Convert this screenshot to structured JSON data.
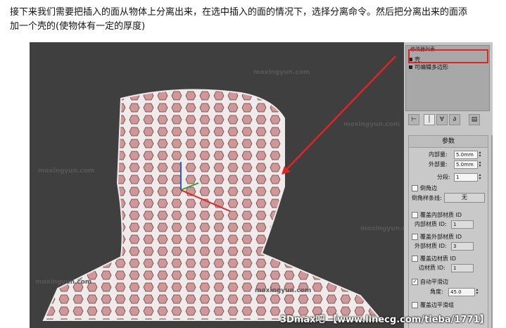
{
  "intro": {
    "line1": "接下来我们需要把插入的面从物体上分离出来，在选中插入的面的情况下，选择分离命令。然后把分离出来的面添",
    "line2": "加一个壳的(使物体有一定的厚度)"
  },
  "watermark": "moxingyun.com",
  "modifier_stack": {
    "header": "修改器列表",
    "items": [
      {
        "label": "壳"
      },
      {
        "label": "可编辑多边形"
      }
    ]
  },
  "parameters": {
    "title": "参数",
    "inner_amount": {
      "label": "内部量:",
      "value": "5.0mm"
    },
    "outer_amount": {
      "label": "外部量:",
      "value": "5.0mm"
    },
    "segments": {
      "label": "分段:",
      "value": "1"
    },
    "bevel_edges": {
      "label": "倒角边"
    },
    "bevel_spline": {
      "label": "倒角样条线:",
      "button": "无"
    },
    "override_inner": {
      "label": "覆盖内部材质 ID",
      "sub_label": "内部材质 ID:",
      "value": "1"
    },
    "override_outer": {
      "label": "覆盖外部材质 ID",
      "sub_label": "外部材质 ID:",
      "value": "3"
    },
    "override_edge": {
      "label": "覆盖边材质 ID",
      "sub_label": "边材质 ID:",
      "value": "1"
    },
    "auto_smooth": {
      "label": "自动平滑边",
      "checked": true
    },
    "angle": {
      "label": "角度:",
      "value": "45.0"
    },
    "override_edge_smooth": {
      "label": "覆盖边平滑组"
    }
  },
  "credit": "3Dmax吧 【www.linecg.com/tieba/1771】",
  "colors": {
    "arrow": "#e02424",
    "mesh": "#d69a9a",
    "edges": "#f2f2f2"
  }
}
